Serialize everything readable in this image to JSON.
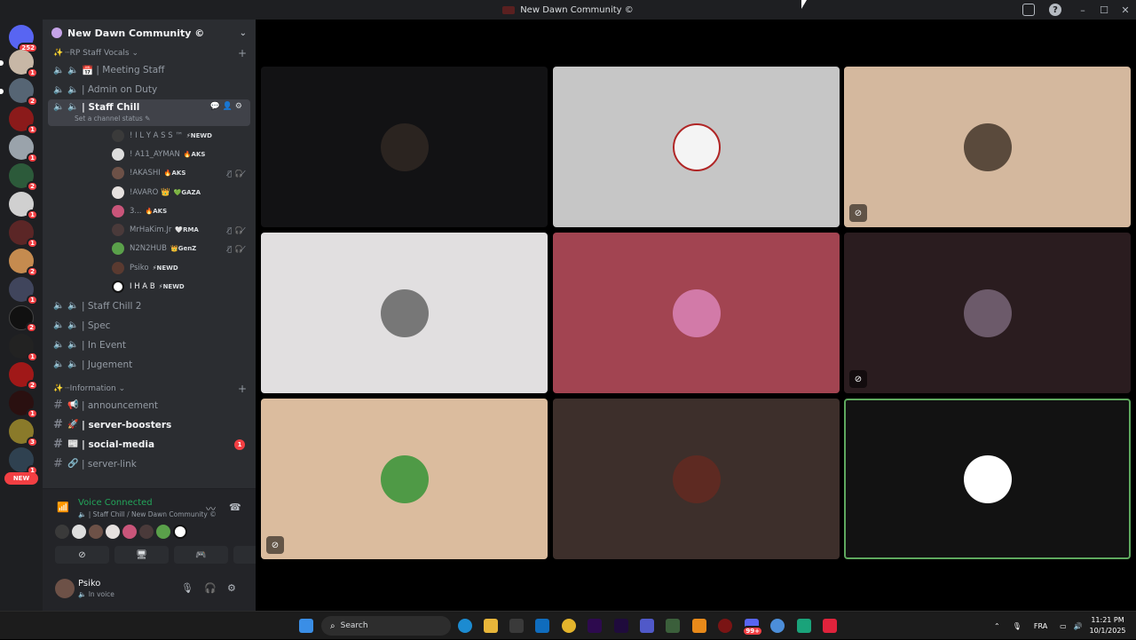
{
  "window": {
    "title": "New Dawn Community ©",
    "min": "–",
    "max": "☐",
    "close": "✕"
  },
  "guilds": {
    "dm_badge": "252",
    "badges": [
      "1",
      "2",
      "1",
      "1",
      "2",
      "1",
      "1",
      "2",
      "1",
      "2",
      "1",
      "2",
      "1",
      "3",
      "1"
    ],
    "new_label": "NEW"
  },
  "server": {
    "name": "New Dawn Community ©",
    "categories": [
      {
        "label": "┈RP Staff Vocals ⌄"
      },
      {
        "label": "┈Information ⌄"
      }
    ],
    "channels": [
      {
        "icon": "📅",
        "name": "| Meeting Staff"
      },
      {
        "icon": "",
        "name": "| Admin on Duty"
      },
      {
        "icon": "",
        "name": "| Staff Chill",
        "status": "Set a channel status ✎"
      },
      {
        "icon": "",
        "name": "| Staff Chill 2"
      },
      {
        "icon": "",
        "name": "| Spec"
      },
      {
        "icon": "",
        "name": "| In Event"
      },
      {
        "icon": "",
        "name": "| Jugement"
      }
    ],
    "text_channels": [
      {
        "icon": "📢",
        "name": "| announcement"
      },
      {
        "icon": "🚀",
        "name": "| server-boosters"
      },
      {
        "icon": "📰",
        "name": "| social-media",
        "mention": "1"
      },
      {
        "icon": "🔗",
        "name": "| server-link"
      }
    ],
    "members": [
      {
        "name": "! I L Y A S S ™",
        "tag": "⚡NEWD"
      },
      {
        "name": "! A11_AYMAN",
        "tag": "🔥AKS"
      },
      {
        "name": "!AKASHI",
        "tag": "🔥AKS"
      },
      {
        "name": "!AVARO 👑",
        "tag": "💚GAZA"
      },
      {
        "name": "3...",
        "tag": "🔥AKS"
      },
      {
        "name": "MrHaKim.Jr",
        "tag": "🤍RMA"
      },
      {
        "name": "N2N2HUB",
        "tag": "👑GenZ"
      },
      {
        "name": "Psiko",
        "tag": "⚡NEWD"
      },
      {
        "name": "I H A B",
        "tag": "⚡NEWD"
      }
    ]
  },
  "voice": {
    "status": "Voice Connected",
    "sub": "🔈 | Staff Chill / New Dawn Community ©"
  },
  "user": {
    "name": "Psiko",
    "sub": "🔈 In voice"
  },
  "taskbar": {
    "search": "Search",
    "lang": "FRA",
    "time": "11:21 PM",
    "date": "10/1/2025",
    "discord_badge": "99+"
  },
  "colors": {
    "accent_green": "#23a55a",
    "badge_red": "#f23f43",
    "speaking_border": "#5ea85e"
  }
}
